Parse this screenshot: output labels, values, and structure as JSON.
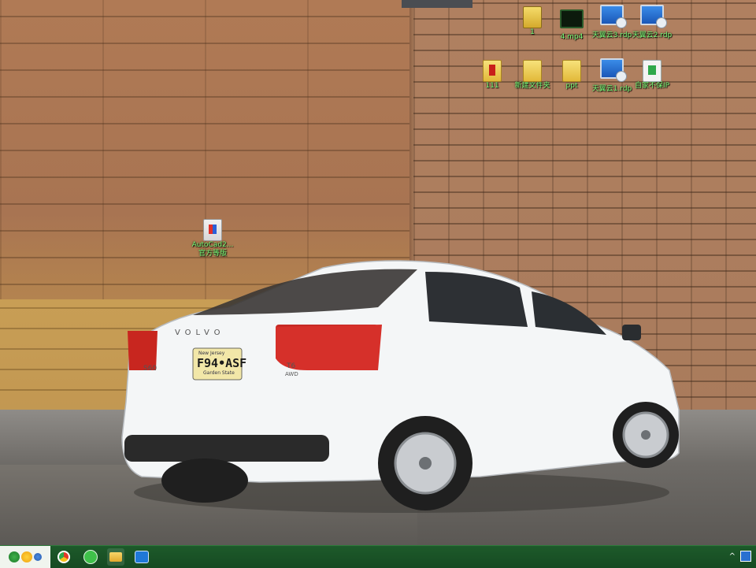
{
  "desktop": {
    "icons": [
      {
        "label": "1",
        "icon": "folder-icon"
      },
      {
        "label": "4.mp4",
        "icon": "video-file-icon"
      },
      {
        "label": "天翼云3.rdp",
        "icon": "remote-desktop-icon"
      },
      {
        "label": "天翼云2.rdp",
        "icon": "remote-desktop-icon"
      },
      {
        "label": "111",
        "icon": "archive-folder-icon"
      },
      {
        "label": "新建文件夹",
        "icon": "folder-icon"
      },
      {
        "label": "ppt",
        "icon": "folder-icon"
      },
      {
        "label": "天翼云1.rdp",
        "icon": "remote-desktop-icon"
      },
      {
        "label": "自家不保IP",
        "icon": "document-icon"
      },
      {
        "label_line1": "AutoCad2...",
        "label_line2": "官方等版",
        "icon": "installer-icon"
      }
    ],
    "wallpaper": {
      "license_plate": "F94•ASF",
      "plate_top": "New Jersey",
      "plate_bottom": "Garden State",
      "brand_text": "VOLVO",
      "model_badge": "S60",
      "trim_badge_top": "T6",
      "trim_badge_bottom": "AWD"
    }
  },
  "taskbar": {
    "apps": [
      "start-button",
      "browser-app",
      "wechat-app",
      "file-explorer-app",
      "video-meeting-app"
    ],
    "tray": {
      "chevron": "^"
    }
  },
  "colors": {
    "label_text": "#7dff7a",
    "taskbar_bg": "#1d5a2a"
  }
}
